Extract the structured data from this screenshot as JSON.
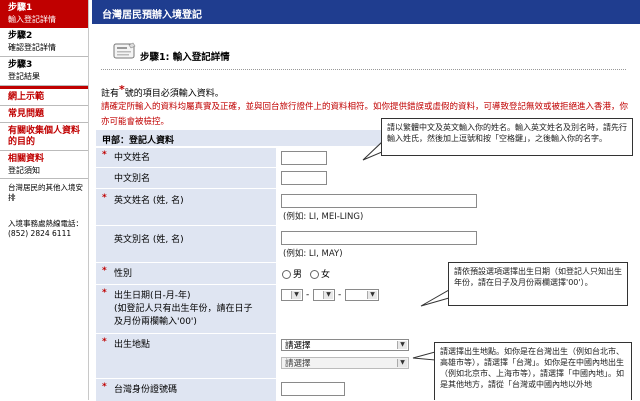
{
  "sidebar": {
    "step1": {
      "title": "步驟1",
      "sub": "輸入登記詳情"
    },
    "step2": {
      "title": "步驟2",
      "sub": "確認登記詳情"
    },
    "step3": {
      "title": "步驟3",
      "sub": "登記結果"
    },
    "links": [
      {
        "label": "網上示範"
      },
      {
        "label": "常見問題"
      },
      {
        "label": "有關收集個人資料的目的"
      },
      {
        "label": "相關資料",
        "sub": "登記須知"
      }
    ],
    "note": "台灣居民的其他入境安排",
    "hotline_label": "入境事務處熱線電話：",
    "hotline_number": "(852) 2824 6111"
  },
  "header": {
    "title": "台灣居民預辦入境登記"
  },
  "step_title": "步驟1: 輸入登記詳情",
  "required_note": {
    "prefix": "註有",
    "star": "*",
    "suffix": "號的項目必須輸入資料。"
  },
  "warning": "請確定所輸入的資料均屬真實及正確，並與回台旅行證件上的資料相符。如你提供錯誤或虛假的資料，可導致登記無效或被拒絕進入香港，你亦可能會被檢控。",
  "section_title": "甲部：登記人資料",
  "form": {
    "chinese_name": {
      "label": "中文姓名",
      "required": "*"
    },
    "chinese_alias": {
      "label": "中文別名"
    },
    "english_name": {
      "label": "英文姓名 (姓, 名)",
      "required": "*",
      "hint": "(例如: LI, MEI-LING)"
    },
    "english_alias": {
      "label": "英文別名 (姓, 名)",
      "hint": "(例如: LI, MAY)"
    },
    "sex": {
      "label": "性別",
      "required": "*",
      "options": [
        "男",
        "女"
      ]
    },
    "dob": {
      "label_line1": "出生日期(日-月-年)",
      "label_line2": "(如登記人只有出生年份，請在日子",
      "label_line3": "及月份兩欄輸入'00')",
      "required": "*",
      "separator": "-"
    },
    "birthplace": {
      "label": "出生地點",
      "required": "*",
      "select1": "請選擇",
      "select2": "請選擇"
    },
    "taiwan_id": {
      "label": "台灣身份證號碼",
      "required": "*"
    }
  },
  "tooltips": {
    "name_tip": "請以繁體中文及英文輸入你的姓名。輸入英文姓名及別名時，請先行輸入姓氏，然後加上逗號和按「空格鍵」，之後輸入你的名字。",
    "dob_tip": "請依預設選項選擇出生日期（如登記人只知出生年份，請在日子及月份兩欄選擇'00'）。",
    "birthplace_tip": "請選擇出生地點。如你是在台灣出生（例如台北市、高雄市等），請選擇「台灣」。如你是在中國內地出生（例如北京市、上海市等），請選擇「中國內地」。如是其他地方，請從「台灣或中國內地以外地"
  },
  "colors": {
    "header_bg": "#1f3d8f",
    "accent_red": "#c00000",
    "form_bg": "#dfe5f2"
  }
}
